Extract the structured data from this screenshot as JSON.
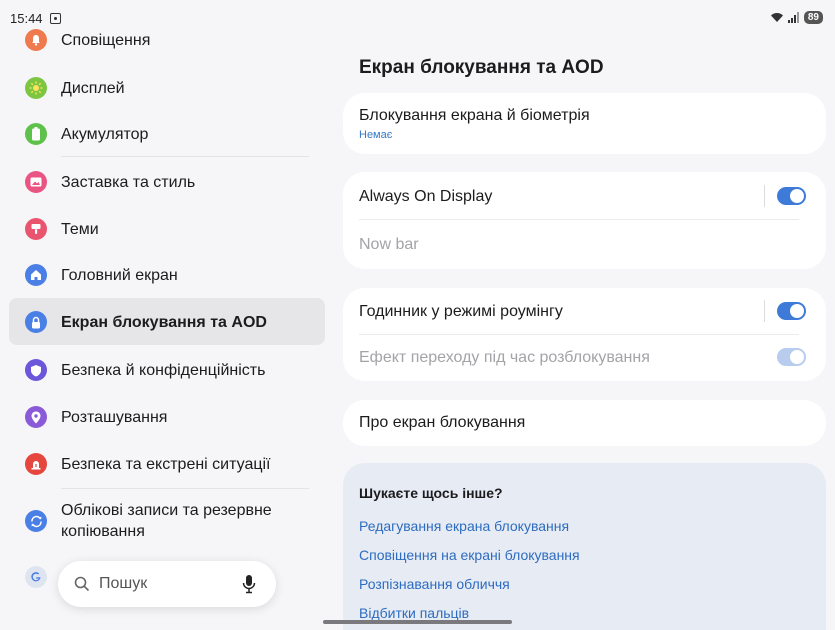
{
  "status_bar": {
    "time": "15:44",
    "battery": "89",
    "icons": [
      "screenshot-icon",
      "wifi-icon",
      "signal-icon"
    ]
  },
  "sidebar": {
    "items": [
      {
        "label": "Сповіщення",
        "icon": "bell-icon",
        "color": "#ef7a4e"
      },
      {
        "label": "Дисплей",
        "icon": "sun-icon",
        "color": "#7dc642"
      },
      {
        "label": "Акумулятор",
        "icon": "battery-icon",
        "color": "#5ec24a"
      },
      {
        "label": "Заставка та стиль",
        "icon": "wallpaper-icon",
        "color": "#e95482"
      },
      {
        "label": "Теми",
        "icon": "brush-icon",
        "color": "#e9546e"
      },
      {
        "label": "Головний екран",
        "icon": "home-icon",
        "color": "#4a7fe6"
      },
      {
        "label": "Екран блокування та AOD",
        "icon": "lock-icon",
        "color": "#4a7fe6",
        "active": true
      },
      {
        "label": "Безпека й конфіденційність",
        "icon": "shield-icon",
        "color": "#6c56d9"
      },
      {
        "label": "Розташування",
        "icon": "location-pin-icon",
        "color": "#8a5ad8"
      },
      {
        "label": "Безпека та екстрені ситуації",
        "icon": "siren-icon",
        "color": "#e5473f"
      },
      {
        "label_line1": "Облікові записи та резервне",
        "label_line2": "копіювання",
        "icon": "sync-icon",
        "color": "#4a7fe6"
      },
      {
        "label": "Google",
        "icon": "google-icon",
        "color": "#4a7fe6"
      }
    ],
    "search": {
      "label": "Пошук"
    }
  },
  "main": {
    "title": "Екран блокування та AOD",
    "lock_card": {
      "title": "Блокування екрана й біометрія",
      "subtitle": "Немає"
    },
    "aod_card": {
      "title": "Always On Display",
      "enabled": true,
      "nowbar": "Now bar"
    },
    "roaming_card": {
      "title": "Годинник у режимі роумінгу",
      "enabled": true,
      "effect": "Ефект переходу під час розблокування",
      "effect_enabled": true
    },
    "about_card": {
      "title": "Про екран блокування"
    },
    "suggestions": {
      "title": "Шукаєте щось інше?",
      "links": [
        "Редагування екрана блокування",
        "Сповіщення на екрані блокування",
        "Розпізнавання обличчя",
        "Відбитки пальців"
      ]
    }
  },
  "colors": {
    "accent": "#3e7bd9",
    "link": "#2d6cc0",
    "active_bg": "#e6e6e9"
  }
}
